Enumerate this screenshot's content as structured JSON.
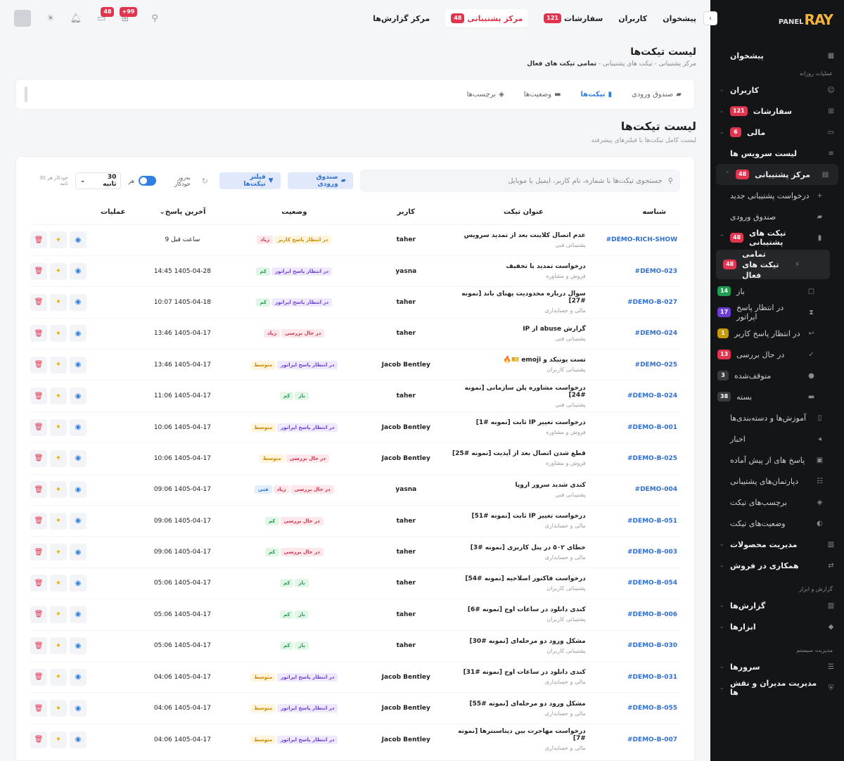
{
  "sidebar": {
    "brand_ray": "RAY",
    "brand_panel": "PANEL",
    "dashboard": "پیشخوان",
    "section_daily": "عملیات روزانه",
    "users": "کاربران",
    "orders": "سفارشات",
    "orders_badge": "121",
    "finance": "مالی",
    "finance_badge": "6",
    "service_list": "لیست سرویس ها",
    "support": "مرکز پشتیبانی",
    "support_badge": "48",
    "new_request": "درخواست پشتیبانی جدید",
    "inbox": "صندوق ورودی",
    "tickets": "تیکت های پشتیبانی",
    "tickets_badge": "48",
    "all_active": "تمامی تیکت های فعال",
    "all_active_badge": "48",
    "open": "باز",
    "open_badge": "14",
    "await_op": "در انتظار پاسخ اپراتور",
    "await_op_badge": "17",
    "await_user": "در انتظار پاسخ کاربر",
    "await_user_badge": "1",
    "reviewing": "در حال بررسی",
    "reviewing_badge": "13",
    "suspended": "متوقف‌شده",
    "suspended_badge": "3",
    "closed": "بسته",
    "closed_badge": "38",
    "tutorials": "آموزش‌ها و دسته‌بندی‌ها",
    "news": "اخبار",
    "canned": "پاسخ های از پیش آماده",
    "departments": "دپارتمان‌های پشتیبانی",
    "ticket_tags": "برچسب‌های تیکت",
    "ticket_status": "وضعیت‌های تیکت",
    "products": "مدیریت محصولات",
    "affiliate": "همکاری در فروش",
    "section_reports": "گزارش و ابزار",
    "reports": "گزارش‌ها",
    "tools": "ابزارها",
    "section_system": "مدیریت سیستم",
    "servers": "سرورها",
    "admins": "مدیریت مدیران و نقش ها"
  },
  "topbar": {
    "nav": [
      {
        "label": "پیشخوان"
      },
      {
        "label": "کاربران"
      },
      {
        "label": "سفارشات",
        "badge": "121"
      },
      {
        "label": "مرکز پشتیبانی",
        "badge": "48"
      },
      {
        "label": "مرکز گزارش‌ها"
      }
    ],
    "msg_badge": "+99",
    "notif_badge": "48"
  },
  "page": {
    "title": "لیست تیکت‌ها",
    "crumb1": "مرکز پشتیبانی",
    "crumb2": "تیکت های پشتیبانی",
    "crumb3": "تمامی تیکت های فعال"
  },
  "tabs": [
    "صندوق ورودی",
    "تیکت‌ها",
    "وضعیت‌ها",
    "برچسب‌ها"
  ],
  "section": {
    "title": "لیست تیکت‌ها",
    "subtitle": "لیست کامل تیکت‌ها با فیلترهای پیشرفته"
  },
  "toolbar": {
    "search_placeholder": "جستجوی تیکت‌ها با شماره، نام کاربر، ایمیل یا موبایل",
    "inbox_btn": "صندوق ورودی",
    "filter_btn": "فیلتر تیکت‌ها",
    "auto_label": "به‌روز خودکار",
    "every": "هر",
    "interval": "30 ثانیه",
    "auto_note": "خودکار هر 30 ثانیه"
  },
  "table": {
    "headers": {
      "id": "شناسه",
      "title": "عنوان تیکت",
      "user": "کاربر",
      "status": "وضعیت",
      "last": "آخرین پاسخ",
      "ops": "عملیات"
    },
    "rows": [
      {
        "id": "#DEMO-RICH-SHOW",
        "title": "عدم اتصال کلاینت بعد از تمدید سرویس",
        "dept": "پشتیبانی فنی",
        "user": "taher",
        "pills": [
          [
            "در انتظار پاسخ کاربر",
            "orange"
          ],
          [
            "زیاد",
            "red"
          ]
        ],
        "time": "9 ساعت قبل"
      },
      {
        "id": "#DEMO-023",
        "title": "درخواست تمدید با تخفیف",
        "dept": "فروش و مشاوره",
        "user": "yasna",
        "pills": [
          [
            "در انتظار پاسخ اپراتور",
            "purple"
          ],
          [
            "کم",
            "green"
          ]
        ],
        "time": "14:45 1405-04-28"
      },
      {
        "id": "#DEMO-B-027",
        "title": "سوال درباره محدودیت پهنای باند [نمونه #27]",
        "dept": "مالی و حسابداری",
        "user": "taher",
        "pills": [
          [
            "در انتظار پاسخ اپراتور",
            "purple"
          ],
          [
            "کم",
            "green"
          ]
        ],
        "time": "10:07 1405-04-18"
      },
      {
        "id": "#DEMO-024",
        "title": "گزارش abuse از IP",
        "dept": "پشتیبانی فنی",
        "user": "taher",
        "pills": [
          [
            "در حال بررسی",
            "red"
          ],
          [
            "زیاد",
            "red"
          ]
        ],
        "time": "13:46 1405-04-17"
      },
      {
        "id": "#DEMO-025",
        "title": "تست یونیکد و emoji 🎫🔥",
        "dept": "پشتیبانی کاربران",
        "user": "Jacob Bentley",
        "pills": [
          [
            "در انتظار پاسخ اپراتور",
            "purple"
          ],
          [
            "متوسط",
            "orange"
          ]
        ],
        "time": "13:46 1405-04-17"
      },
      {
        "id": "#DEMO-B-024",
        "title": "درخواست مشاوره پلن سازمانی [نمونه #24]",
        "dept": "پشتیبانی فنی",
        "user": "taher",
        "pills": [
          [
            "باز",
            "green"
          ],
          [
            "کم",
            "green"
          ]
        ],
        "time": "11:06 1405-04-17"
      },
      {
        "id": "#DEMO-B-001",
        "title": "درخواست تغییر IP ثابت [نمونه #1]",
        "dept": "فروش و مشاوره",
        "user": "Jacob Bentley",
        "pills": [
          [
            "در انتظار پاسخ اپراتور",
            "purple"
          ],
          [
            "متوسط",
            "orange"
          ]
        ],
        "time": "10:06 1405-04-17"
      },
      {
        "id": "#DEMO-B-025",
        "title": "قطع شدن اتصال بعد از آپدیت [نمونه #25]",
        "dept": "فروش و مشاوره",
        "user": "Jacob Bentley",
        "pills": [
          [
            "در حال بررسی",
            "red"
          ],
          [
            "متوسط",
            "orange"
          ]
        ],
        "time": "10:06 1405-04-17"
      },
      {
        "id": "#DEMO-004",
        "title": "کندی شدید سرور اروپا",
        "dept": "پشتیبانی فنی",
        "user": "yasna",
        "pills": [
          [
            "در حال بررسی",
            "red"
          ],
          [
            "زیاد",
            "red"
          ],
          [
            "فنی",
            "blue"
          ]
        ],
        "time": "09:06 1405-04-17"
      },
      {
        "id": "#DEMO-B-051",
        "title": "درخواست تغییر IP ثابت [نمونه #51]",
        "dept": "مالی و حسابداری",
        "user": "taher",
        "pills": [
          [
            "در حال بررسی",
            "red"
          ],
          [
            "کم",
            "green"
          ]
        ],
        "time": "09:06 1405-04-17"
      },
      {
        "id": "#DEMO-B-003",
        "title": "خطای ۵۰۲ در پنل کاربری [نمونه #3]",
        "dept": "مالی و حسابداری",
        "user": "taher",
        "pills": [
          [
            "در حال بررسی",
            "red"
          ],
          [
            "کم",
            "green"
          ]
        ],
        "time": "09:06 1405-04-17"
      },
      {
        "id": "#DEMO-B-054",
        "title": "درخواست فاکتور اصلاحیه [نمونه #54]",
        "dept": "پشتیبانی کاربران",
        "user": "taher",
        "pills": [
          [
            "باز",
            "green"
          ],
          [
            "کم",
            "green"
          ]
        ],
        "time": "05:06 1405-04-17"
      },
      {
        "id": "#DEMO-B-006",
        "title": "کندی دانلود در ساعات اوج [نمونه #6]",
        "dept": "پشتیبانی کاربران",
        "user": "taher",
        "pills": [
          [
            "باز",
            "green"
          ],
          [
            "کم",
            "green"
          ]
        ],
        "time": "05:06 1405-04-17"
      },
      {
        "id": "#DEMO-B-030",
        "title": "مشکل ورود دو مرحله‌ای [نمونه #30]",
        "dept": "پشتیبانی کاربران",
        "user": "taher",
        "pills": [
          [
            "باز",
            "green"
          ],
          [
            "کم",
            "green"
          ]
        ],
        "time": "05:06 1405-04-17"
      },
      {
        "id": "#DEMO-B-031",
        "title": "کندی دانلود در ساعات اوج [نمونه #31]",
        "dept": "مالی و حسابداری",
        "user": "Jacob Bentley",
        "pills": [
          [
            "در انتظار پاسخ اپراتور",
            "purple"
          ],
          [
            "متوسط",
            "orange"
          ]
        ],
        "time": "04:06 1405-04-17"
      },
      {
        "id": "#DEMO-B-055",
        "title": "مشکل ورود دو مرحله‌ای [نمونه #55]",
        "dept": "مالی و حسابداری",
        "user": "Jacob Bentley",
        "pills": [
          [
            "در انتظار پاسخ اپراتور",
            "purple"
          ],
          [
            "متوسط",
            "orange"
          ]
        ],
        "time": "04:06 1405-04-17"
      },
      {
        "id": "#DEMO-B-007",
        "title": "درخواست مهاجرت بین دیتاسنترها [نمونه #7]",
        "dept": "مالی و حسابداری",
        "user": "Jacob Bentley",
        "pills": [
          [
            "در انتظار پاسخ اپراتور",
            "purple"
          ],
          [
            "متوسط",
            "orange"
          ]
        ],
        "time": "04:06 1405-04-17"
      }
    ]
  }
}
